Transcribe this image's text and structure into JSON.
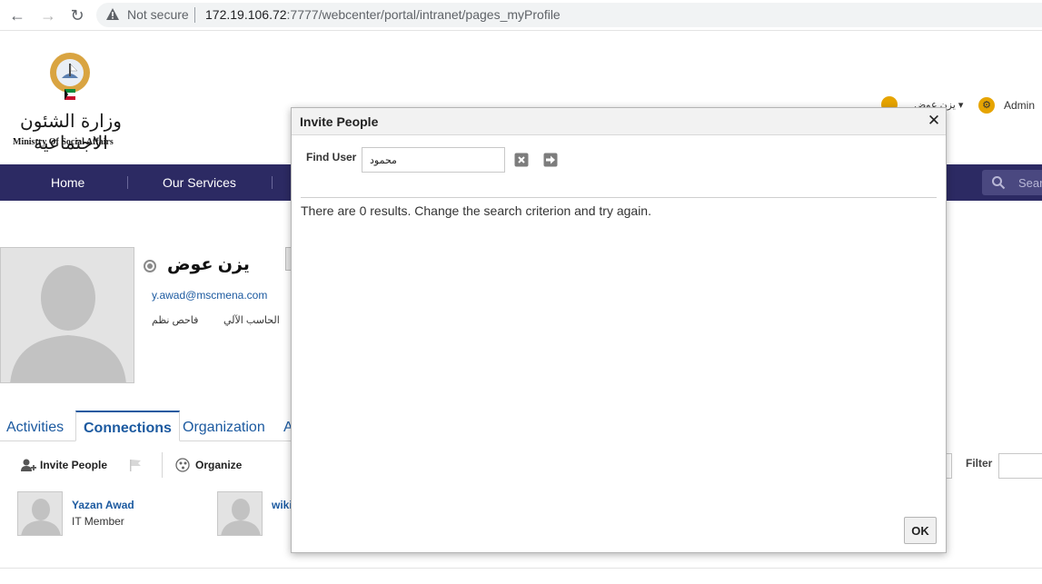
{
  "browser": {
    "security_label": "Not secure",
    "url_host": "172.19.106.72",
    "url_rest": ":7777/webcenter/portal/intranet/pages_myProfile"
  },
  "header": {
    "logo_text_ar": "وزارة الشئون الاجتماعية",
    "logo_text_en": "Ministry Of Social Affairs",
    "user_menu_label": "يزن عوض ▾",
    "admin_label": "Admin"
  },
  "nav": {
    "items": [
      "Home",
      "Our Services"
    ],
    "search_placeholder": "Sear"
  },
  "profile": {
    "name": "يزن عوض",
    "email": "y.awad@mscmena.com",
    "department": "الحاسب الآلي",
    "title": "فاحص نظم"
  },
  "tabs": [
    {
      "label": "Activities"
    },
    {
      "label": "Connections"
    },
    {
      "label": "Organization"
    },
    {
      "label": "A"
    }
  ],
  "toolbar": {
    "invite_label": "Invite People",
    "organize_label": "Organize",
    "filter_label": "Filter"
  },
  "connections": [
    {
      "name": "Yazan Awad",
      "role": "IT Member"
    },
    {
      "name": "wiki",
      "role": ""
    }
  ],
  "dialog": {
    "title": "Invite People",
    "close_label": "✕",
    "find_label": "Find User",
    "find_value": "محمود",
    "results_message": "There are 0 results. Change the search criterion and try again.",
    "ok_label": "OK"
  },
  "colors": {
    "nav_bg": "#2c2a63",
    "link": "#1c5aa0",
    "accent": "#e6a400"
  }
}
